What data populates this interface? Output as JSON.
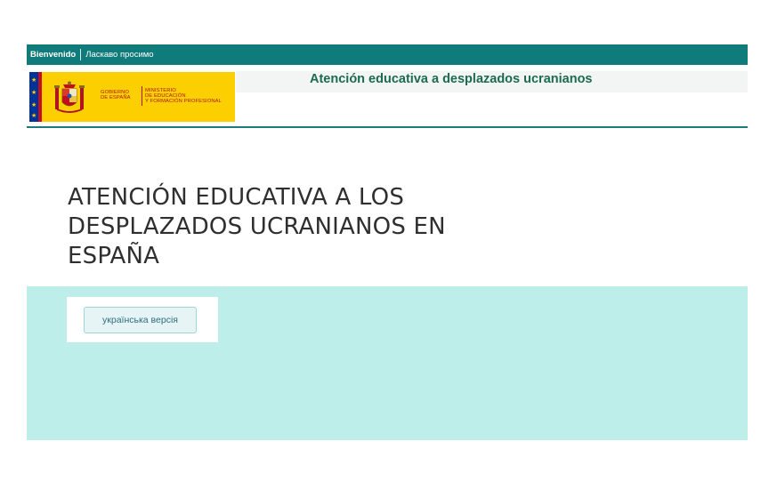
{
  "topbar": {
    "lang_active": "Bienvenido",
    "lang_other": "Ласкаво просимо"
  },
  "header": {
    "site_title": "Atención educativa a desplazados ucranianos",
    "logo": {
      "gov_line1": "GOBIERNO",
      "gov_line2": "DE ESPAÑA",
      "min_line1": "MINISTERIO",
      "min_line2": "DE EDUCACIÓN",
      "min_line3": "Y FORMACIÓN PROFESIONAL"
    }
  },
  "main": {
    "heading_line1": "ATENCIÓN EDUCATIVA A LOS",
    "heading_line2": "DESPLAZADOS UCRANIANOS EN",
    "heading_line3": "ESPAÑA",
    "ukrainian_button_label": "українська версія"
  },
  "colors": {
    "topbar": "#0f7b7b",
    "title_green": "#1b6b4f",
    "band": "#bdeeea",
    "logo_yellow": "#fbcf00",
    "logo_red": "#b0151f"
  },
  "icons": {
    "eu_flag": "eu-flag-icon",
    "coat_of_arms": "spain-coat-of-arms-icon"
  }
}
